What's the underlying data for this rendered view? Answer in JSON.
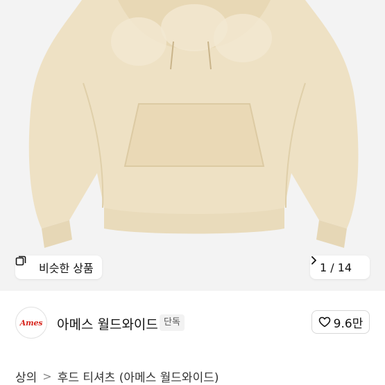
{
  "gallery": {
    "similar_products_label": "비슷한 상품",
    "pager": "1 / 14",
    "product_colors": {
      "background": "#f3f3f3",
      "garment": "#eee1c4",
      "shadow": "#d9c9a6"
    }
  },
  "brand": {
    "logo_text": "Ames",
    "name": "아메스 월드와이드",
    "badge": "단독",
    "likes": "9.6만"
  },
  "breadcrumb": {
    "items": [
      "상의",
      "후드 티셔츠 (아메스 월드와이드)"
    ],
    "separator": ">"
  },
  "colors": {
    "accent_logo": "#d7261e",
    "text": "#111111"
  }
}
